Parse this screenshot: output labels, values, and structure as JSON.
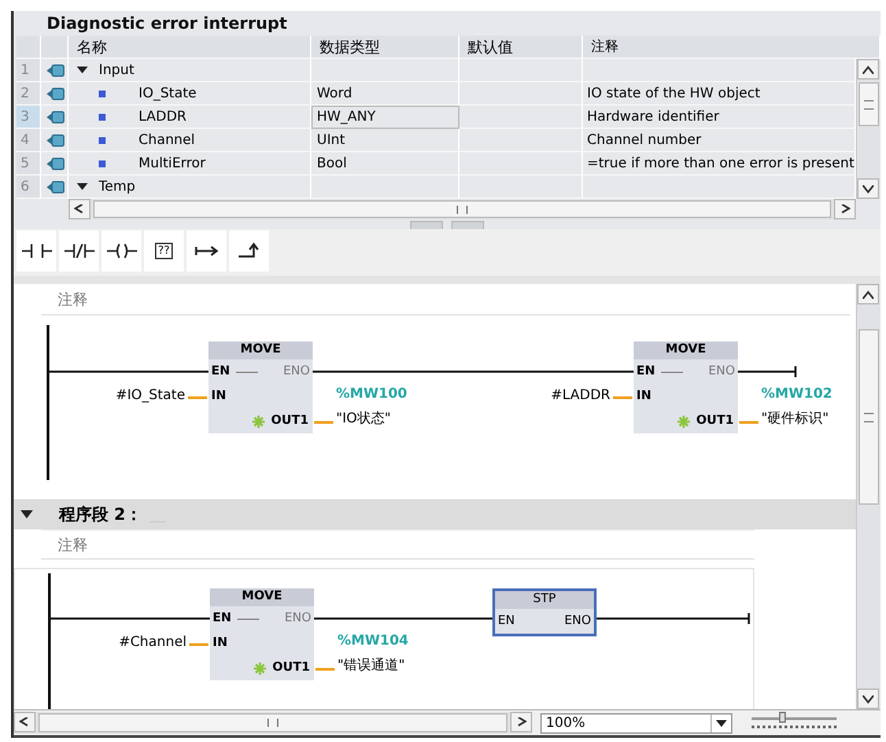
{
  "interface": {
    "title": "Diagnostic error interrupt",
    "columns": [
      "名称",
      "数据类型",
      "默认值",
      "注释"
    ],
    "rows": [
      {
        "number": "1",
        "name": "Input",
        "expanded": true,
        "selected": false,
        "children": [
          {
            "number": "2",
            "name": "IO_State",
            "data_type": "Word",
            "comment": "IO state of the HW object",
            "selected": false
          },
          {
            "number": "3",
            "name": "LADDR",
            "data_type": "HW_ANY",
            "comment": "Hardware identifier",
            "selected": true
          },
          {
            "number": "4",
            "name": "Channel",
            "data_type": "UInt",
            "comment": "Channel number",
            "selected": false
          },
          {
            "number": "5",
            "name": "MultiError",
            "data_type": "Bool",
            "comment": "=true if more than one error is present",
            "selected": false
          }
        ]
      },
      {
        "number": "6",
        "name": "Temp",
        "expanded": true,
        "selected": false
      }
    ]
  },
  "toolbar": [
    {
      "kind": "no-contact"
    },
    {
      "kind": "nc-contact"
    },
    {
      "kind": "coil"
    },
    {
      "kind": "empty-box",
      "label": "??"
    },
    {
      "kind": "open-branch"
    },
    {
      "kind": "close-branch"
    }
  ],
  "networks": [
    {
      "selected": false,
      "comment": "注释",
      "blocks": [
        {
          "kind": "move",
          "name": "MOVE",
          "selected": false,
          "en": "EN",
          "eno": "ENO",
          "in": "IN",
          "out": "OUT1",
          "input": "#IO_State",
          "address": "%MW100",
          "symbol": "\"IO状态\""
        },
        {
          "kind": "move",
          "name": "MOVE",
          "selected": false,
          "en": "EN",
          "eno": "ENO",
          "in": "IN",
          "out": "OUT1",
          "input": "#LADDR",
          "address": "%MW102",
          "symbol": "\"硬件标识\""
        }
      ]
    },
    {
      "title": "程序段 2：",
      "expanded": true,
      "selected": true,
      "comment": "注释",
      "blocks": [
        {
          "kind": "move",
          "name": "MOVE",
          "selected": false,
          "en": "EN",
          "eno": "ENO",
          "in": "IN",
          "out": "OUT1",
          "input": "#Channel",
          "address": "%MW104",
          "symbol": "\"错误通道\""
        },
        {
          "kind": "call",
          "name": "STP",
          "selected": true,
          "en": "EN",
          "eno": "ENO"
        }
      ]
    }
  ],
  "zoom": {
    "value": "100%",
    "level": 0.35
  }
}
